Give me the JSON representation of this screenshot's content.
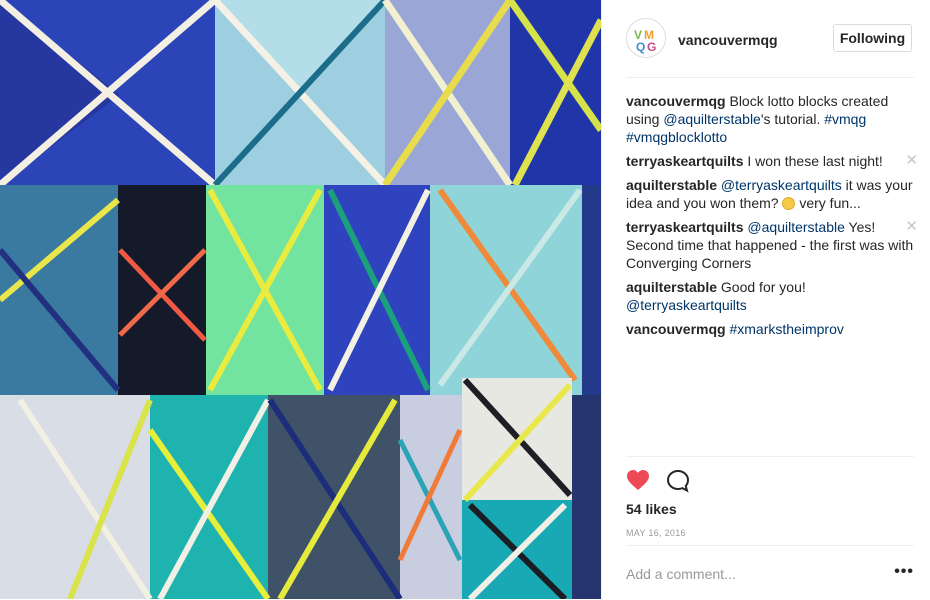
{
  "post": {
    "photo_alt": "quilt block lotto photo",
    "account": "vancouvermqg",
    "avatar_initials": "VMQG",
    "follow_label": "Following"
  },
  "comments": [
    {
      "user": "vancouvermqg",
      "parts": [
        {
          "t": "Block lotto blocks created using ",
          "link": false
        },
        {
          "t": "@aquilterstable",
          "link": true
        },
        {
          "t": "'s tutorial. ",
          "link": false
        },
        {
          "t": "#vmqg",
          "link": true
        },
        {
          "t": " ",
          "link": false
        },
        {
          "t": "#vmqgblocklotto",
          "link": true
        }
      ],
      "has_delete": false
    },
    {
      "user": "terryaskeartquilts",
      "parts": [
        {
          "t": "I won these last night!",
          "link": false
        }
      ],
      "has_delete": true
    },
    {
      "user": "aquilterstable",
      "parts": [
        {
          "t": "@terryaskeartquilts",
          "link": true
        },
        {
          "t": " it was your idea and you won them? ",
          "link": false
        },
        {
          "emoji": "winking-face"
        },
        {
          "t": " very fun...",
          "link": false
        }
      ],
      "has_delete": false
    },
    {
      "user": "terryaskeartquilts",
      "parts": [
        {
          "t": "@aquilterstable",
          "link": true
        },
        {
          "t": " Yes! Second time that happened - the first was with Converging Corners",
          "link": false
        }
      ],
      "has_delete": true
    },
    {
      "user": "aquilterstable",
      "parts": [
        {
          "t": "Good for you! ",
          "link": false
        },
        {
          "t": "@terryaskeartquilts",
          "link": true
        }
      ],
      "has_delete": false
    },
    {
      "user": "vancouvermqg",
      "parts": [
        {
          "t": "#xmarkstheimprov",
          "link": true
        }
      ],
      "has_delete": false
    }
  ],
  "icons": {
    "like": "heart-icon",
    "comment": "comment-bubble-icon",
    "delete": "close-icon",
    "more": "more-options-icon"
  },
  "likes_text": "54 likes",
  "date_text": "MAY 16, 2016",
  "add_comment_placeholder": "Add a comment...",
  "more_label": "•••",
  "delete_glyph": "✕",
  "colors": {
    "link": "#003569",
    "heart": "#ed4956",
    "border": "#efefef",
    "muted": "#999999"
  }
}
